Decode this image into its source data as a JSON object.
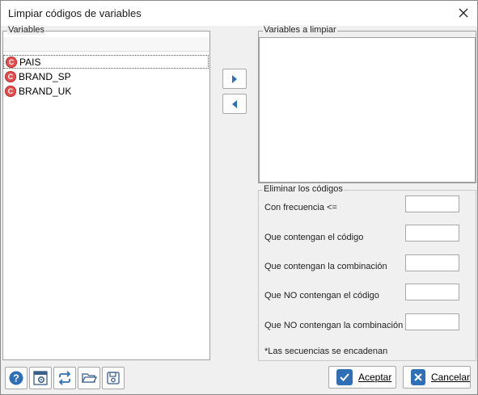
{
  "window": {
    "title": "Limpiar códigos de variables",
    "close_icon": "close-icon"
  },
  "left_panel": {
    "label": "Variables",
    "items": [
      {
        "badge": "C",
        "label": "PAIS",
        "selected": true
      },
      {
        "badge": "C",
        "label": "BRAND_SP",
        "selected": false
      },
      {
        "badge": "C",
        "label": "BRAND_UK",
        "selected": false
      }
    ]
  },
  "right_panel": {
    "label": "Variables a limpiar",
    "items": []
  },
  "codes": {
    "label": "Eliminar los códigos",
    "rows": [
      {
        "label": "Con frecuencia <=",
        "value": ""
      },
      {
        "label": "Que contengan el código",
        "value": ""
      },
      {
        "label": "Que contengan la combinación",
        "value": ""
      },
      {
        "label": "Que NO contengan el código",
        "value": ""
      },
      {
        "label": "Que NO contengan la combinación",
        "value": ""
      }
    ],
    "footnote": "*Las secuencias se encadenan"
  },
  "buttons": {
    "accept_label": "Aceptar",
    "cancel_label": "Cancelar"
  },
  "toolbar_icons": [
    "help-icon",
    "settings-icon",
    "refresh-icon",
    "open-folder-icon",
    "save-icon"
  ],
  "colors": {
    "badge": "#e05050",
    "arrow": "#2f6fb5",
    "accept_icon_bg": "#2f6fb5",
    "cancel_icon_bg": "#2f6fb5"
  }
}
